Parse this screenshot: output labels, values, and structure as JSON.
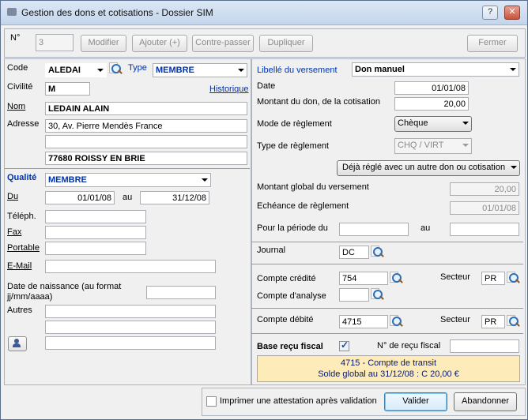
{
  "window": {
    "title": "Gestion des dons et cotisations - Dossier SIM"
  },
  "toolbar": {
    "num_label": "N°",
    "num_value": "3",
    "modifier": "Modifier",
    "ajouter": "Ajouter (+)",
    "contre_passer": "Contre-passer",
    "dupliquer": "Dupliquer",
    "fermer": "Fermer"
  },
  "left": {
    "code_label": "Code",
    "code_value": "ALEDAI",
    "type_label": "Type",
    "type_value": "MEMBRE",
    "civilite_label": "Civilité",
    "civilite_value": "M",
    "historique": "Historique",
    "nom_label": "Nom",
    "nom_value": "LEDAIN ALAIN",
    "adresse_label": "Adresse",
    "adresse_line1": "30, Av. Pierre Mendès France",
    "adresse_line2": "",
    "adresse_line3": "77680 ROISSY EN BRIE",
    "qualite_label": "Qualité",
    "qualite_value": "MEMBRE",
    "du_label": "Du",
    "du_value": "01/01/08",
    "au_label": "au",
    "au_value": "31/12/08",
    "teleph_label": "Téléph.",
    "fax_label": "Fax",
    "portable_label": "Portable",
    "email_label": "E-Mail",
    "naissance_label_1": "Date de naissance (au format",
    "naissance_label_2": "jj/mm/aaaa)",
    "autres_label": "Autres"
  },
  "right": {
    "libelle_label": "Libellé du versement",
    "libelle_value": "Don manuel",
    "date_label": "Date",
    "date_value": "01/01/08",
    "montant_label": "Montant du don, de la cotisation",
    "montant_value": "20,00",
    "mode_label": "Mode de règlement",
    "mode_value": "Chèque",
    "type_reglement_label": "Type de règlement",
    "type_reglement_value": "CHQ / VIRT",
    "deja_regle": "Déjà réglé avec un autre don ou cotisation",
    "montant_global_label": "Montant global du versement",
    "montant_global_value": "20,00",
    "echeance_label": "Echéance de règlement",
    "echeance_value": "01/01/08",
    "periode_label": "Pour la période du",
    "periode_au": "au",
    "journal_label": "Journal",
    "journal_value": "DC",
    "compte_credite_label": "Compte crédité",
    "compte_credite_value": "754",
    "secteur_label": "Secteur",
    "secteur1_value": "PR",
    "compte_analyse_label": "Compte d'analyse",
    "compte_debite_label": "Compte débité",
    "compte_debite_value": "4715",
    "secteur2_value": "PR",
    "base_recu_label": "Base reçu fiscal",
    "base_recu_checked": true,
    "num_recu_label": "N° de reçu fiscal",
    "info_line1": "4715 - Compte de transit",
    "info_line2": "Solde global au 31/12/08 : C 20,00 €"
  },
  "footer": {
    "imprimer_label": "Imprimer une attestation après validation",
    "valider": "Valider",
    "abandonner": "Abandonner"
  },
  "colors": {
    "accent_blue": "#0033aa",
    "info_bg": "#fdecb9"
  }
}
